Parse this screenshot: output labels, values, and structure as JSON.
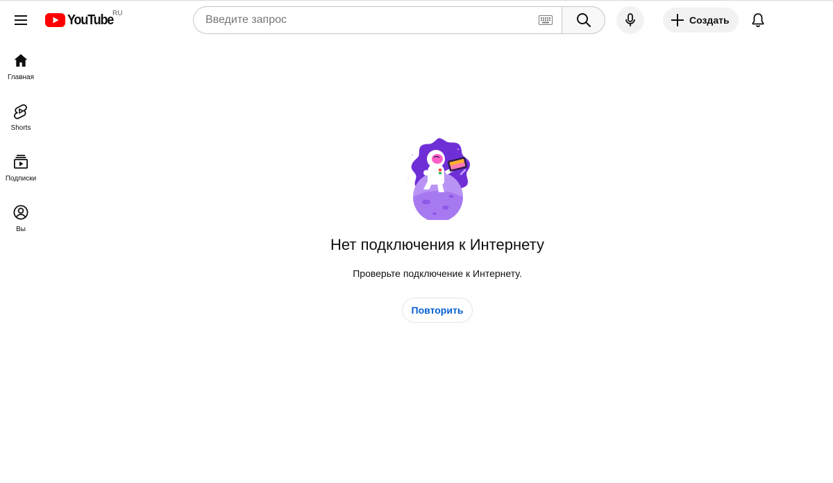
{
  "masthead": {
    "logo_text": "YouTube",
    "country_code": "RU",
    "search": {
      "placeholder": "Введите запрос"
    },
    "create_label": "Создать"
  },
  "guide": {
    "items": [
      {
        "label": "Главная",
        "icon": "home-icon"
      },
      {
        "label": "Shorts",
        "icon": "shorts-icon"
      },
      {
        "label": "Подписки",
        "icon": "subscriptions-icon"
      },
      {
        "label": "Вы",
        "icon": "account-icon"
      }
    ]
  },
  "offline": {
    "title": "Нет подключения к Интернету",
    "subtitle": "Проверьте подключение к Интернету.",
    "retry_label": "Повторить",
    "illustration": "astronaut-on-planet-illustration"
  },
  "colors": {
    "brand_red": "#ff0000",
    "link_blue": "#065fd4",
    "illustration_purple": "#6f2fd6"
  }
}
